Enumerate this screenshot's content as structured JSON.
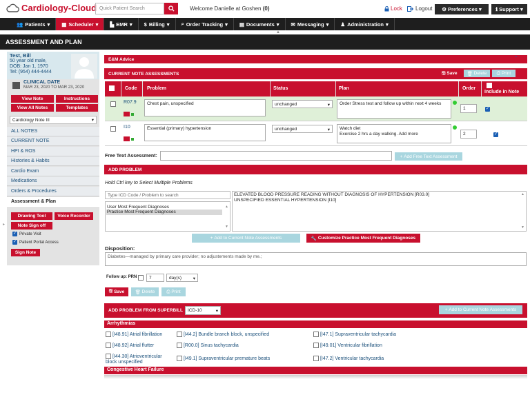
{
  "app": {
    "name": "Cardiology-Cloud"
  },
  "top": {
    "search_placeholder": "Quick Patient Search",
    "welcome": "Welcome Danielle at Goshen",
    "welcome_count": "(0)",
    "lock": "Lock",
    "logout": "Logout",
    "preferences": "Preferences",
    "support": "Support"
  },
  "nav": [
    {
      "label": "Patients",
      "icon": "users-icon"
    },
    {
      "label": "Scheduler",
      "icon": "calendar-icon"
    },
    {
      "label": "EMR",
      "icon": "chart-icon"
    },
    {
      "label": "Billing",
      "icon": "dollar-icon"
    },
    {
      "label": "Order Tracking",
      "icon": "search-icon"
    },
    {
      "label": "Documents",
      "icon": "document-icon"
    },
    {
      "label": "Messaging",
      "icon": "mail-icon"
    },
    {
      "label": "Administration",
      "icon": "admin-icon"
    }
  ],
  "page_title": "ASSESSMENT AND PLAN",
  "patient": {
    "name": "Test, Bill",
    "line1": "50 year old male,",
    "dob": "DOB: Jan 1, 1970",
    "tel": "Tel: (954) 444-4444",
    "clinical_date_label": "CLINICAL DATE",
    "clinical_date": "MAR 23, 2020 TO MAR 23, 2020"
  },
  "left_buttons": {
    "view_note": "View Note",
    "instructions": "Instructions",
    "view_all_notes": "View All Notes",
    "templates": "Templates"
  },
  "note_select": "Cardiology Note III",
  "left_items": [
    "ALL NOTES",
    "CURRENT NOTE",
    "HPI & ROS",
    "Histories & Habits",
    "Cardio Exam",
    "Medications",
    "Orders & Procedures",
    "Assessment & Plan"
  ],
  "left_tools": {
    "drawing_tool": "Drawing Tool",
    "voice_recorder": "Voice Recorder",
    "note_sign_off": "Note Sign off",
    "private_visit": "Private Visit",
    "portal_access": "Patient Portal Access",
    "sign_note": "Sign Note"
  },
  "em_advice": "E&M Advice",
  "current_assessments": {
    "header": "CURRENT NOTE ASSESSMENTS",
    "save": "Save",
    "delete": "Delete",
    "print": "Print",
    "columns": [
      "Code",
      "Problem",
      "Status",
      "Plan",
      "Order",
      "Include in Note"
    ],
    "rows": [
      {
        "code": "R07.9",
        "problem": "Chest pain, unspecified",
        "status": "unchanged",
        "plan": "Order Stress test and follow up within next 4 weeks",
        "order": "1"
      },
      {
        "code": "I10",
        "problem": "Essential (primary) hypertension",
        "status": "unchanged",
        "plan": "Watch diet\nExercise 2 hrs a day walking. Add more",
        "order": "2"
      }
    ]
  },
  "free_text": {
    "label": "Free Text Assessment:",
    "button": "Add Free Text Assessment"
  },
  "add_problem": {
    "header": "ADD PROBLEM",
    "hint": "Hold Ctrl key to Select Multiple Problems",
    "icd_placeholder": "Type ICD Code / Problem to search",
    "list_options": [
      "User Most Frequent Diagnoses",
      "Practice Most Frequent Diagnoses"
    ],
    "results": [
      "ELEVATED BLOOD PRESSURE READING WITHOUT DIAGNOSIS OF HYPERTENSION [R03.0]",
      "UNSPECIFIED ESSENTIAL HYPERTENSION [I10]"
    ],
    "add_button": "Add to Current Note Assessments",
    "customize_button": "Customize Practice Most Frequent Diagnoses"
  },
  "disposition": {
    "label": "Disposition:",
    "value": "Diabetes—managed by primary care provider; no adjustements made by me.;"
  },
  "followup": {
    "label": "Follow up: PRN",
    "value": "7",
    "unit": "day(s)"
  },
  "bottom_buttons": {
    "save": "Save",
    "delete": "Delete",
    "print": "Print"
  },
  "superbill": {
    "header": "ADD PROBLEM FROM SUPERBILL",
    "select": "ICD-10",
    "add_button": "Add to Current Note Assessments",
    "group1": "Arrhythmias",
    "items": [
      "[I48.91] Atrial fibrillation",
      "[I44.2] Bundle branch block, unspecified",
      "[I47.1] Supraventricular tachycardia",
      "[I48.92] Atrial flutter",
      "[R00.0] Sinus tachycardia",
      "[I49.01] Ventricular fibrillation",
      "[I44.30] Atrioventricular block unspecified",
      "[I49.1] Supraventricular premature beats",
      "[I47.2] Ventricular tachycardia"
    ],
    "group2": "Congestive Heart Failure"
  }
}
